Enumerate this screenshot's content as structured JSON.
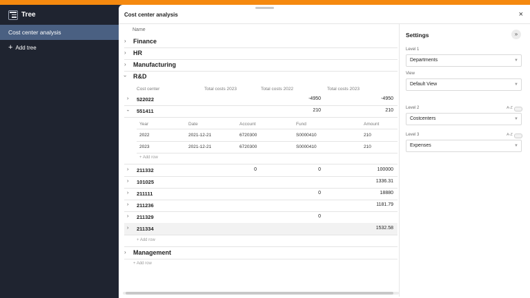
{
  "sidebar": {
    "title": "Tree",
    "items": [
      {
        "label": "Cost center analysis",
        "active": true
      }
    ],
    "add_label": "Add tree"
  },
  "panel": {
    "title": "Cost center analysis",
    "close": "×"
  },
  "main": {
    "name_header": "Name",
    "groups": [
      "Finance",
      "HR",
      "Manufacturing",
      "R&D",
      "Management"
    ],
    "cc_headers": [
      "Cost center",
      "Total costs 2023",
      "Total costs 2022",
      "Total costs 2023"
    ],
    "rows": [
      {
        "id": "522022",
        "c1": "",
        "c2": "-4950",
        "c3": "-4950"
      },
      {
        "id": "551411",
        "c1": "",
        "c2": "210",
        "c3": "210"
      },
      {
        "id": "211332",
        "c1": "0",
        "c2": "0",
        "c3": "100000"
      },
      {
        "id": "101025",
        "c1": "",
        "c2": "",
        "c3": "1336.31"
      },
      {
        "id": "211111",
        "c1": "",
        "c2": "0",
        "c3": "18880"
      },
      {
        "id": "211236",
        "c1": "",
        "c2": "",
        "c3": "1181.79"
      },
      {
        "id": "211329",
        "c1": "",
        "c2": "0",
        "c3": ""
      },
      {
        "id": "211334",
        "c1": "",
        "c2": "",
        "c3": "1532.58"
      }
    ],
    "sub_headers": [
      "Year",
      "Date",
      "Account",
      "Fund",
      "Amount"
    ],
    "sub_rows": [
      [
        "2022",
        "2021-12-21",
        "6720300",
        "S0000410",
        "210"
      ],
      [
        "2023",
        "2021-12-21",
        "6720300",
        "S0000410",
        "210"
      ]
    ],
    "add_row": "+ Add row",
    "add_row_cc": "+ Add row",
    "add_row_group": "+ Add row"
  },
  "settings": {
    "title": "Settings",
    "collapse_icon": "»",
    "level1_label": "Level 1",
    "level1_value": "Departments",
    "view_label": "View",
    "view_value": "Default View",
    "level2_label": "Level 2",
    "level2_value": "Costcenters",
    "level3_label": "Level 3",
    "level3_value": "Expenses",
    "az": "A-Z",
    "caret": "▼"
  },
  "colors": {
    "accent": "#f5890f",
    "sidebar_bg": "#1f2430",
    "active_item": "#4a6082"
  }
}
